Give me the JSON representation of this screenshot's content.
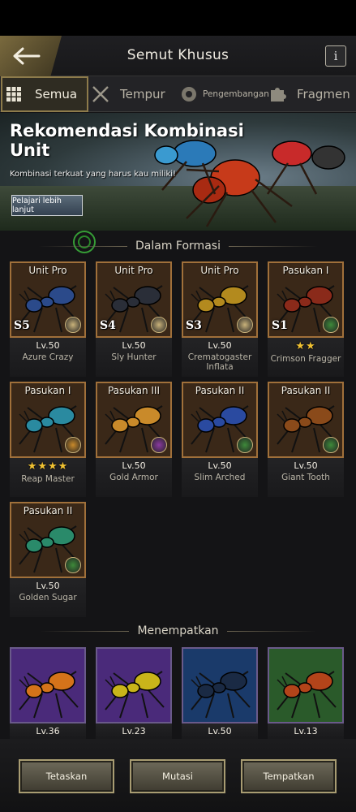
{
  "header": {
    "title": "Semut Khusus",
    "back_icon": "arrow-left-icon",
    "info_label": "i"
  },
  "tabs": [
    {
      "label": "Semua",
      "icon": "grid-icon",
      "active": true
    },
    {
      "label": "Tempur",
      "icon": "crossed-swords-icon",
      "active": false
    },
    {
      "label": "Pengembangan",
      "icon": "gear-shield-icon",
      "active": false
    },
    {
      "label": "Fragmen",
      "icon": "puzzle-icon",
      "active": false
    }
  ],
  "banner": {
    "title": "Rekomendasi Kombinasi Unit",
    "subtitle": "Kombinasi terkuat yang harus kau miliki!",
    "button_label": "Pelajari lebih lanjut"
  },
  "formation": {
    "heading": "Dalam Formasi",
    "units": [
      {
        "rank": "Unit Pro",
        "tier": "S5",
        "level": "Lv.50",
        "name": "Azure Crazy",
        "stars": "",
        "body": "#2b4a8a",
        "badge": "#c9b27a"
      },
      {
        "rank": "Unit Pro",
        "tier": "S4",
        "level": "Lv.50",
        "name": "Sly Hunter",
        "stars": "",
        "body": "#2a2e38",
        "badge": "#c9b27a"
      },
      {
        "rank": "Unit Pro",
        "tier": "S3",
        "level": "Lv.50",
        "name": "Crematogaster Inflata",
        "stars": "",
        "body": "#b38a1e",
        "badge": "#c9b27a"
      },
      {
        "rank": "Pasukan I",
        "tier": "S1",
        "level": "",
        "name": "Crimson Fragger",
        "stars": "★★",
        "body": "#8a2a1a",
        "badge": "#3e8a3a"
      },
      {
        "rank": "Pasukan I",
        "tier": "",
        "level": "",
        "name": "Reap Master",
        "stars": "★★★★",
        "body": "#2a8aa0",
        "badge": "#c98a2a"
      },
      {
        "rank": "Pasukan III",
        "tier": "",
        "level": "Lv.50",
        "name": "Gold Armor",
        "stars": "",
        "body": "#c98a2a",
        "badge": "#8a3aa0"
      },
      {
        "rank": "Pasukan II",
        "tier": "",
        "level": "Lv.50",
        "name": "Slim Arched",
        "stars": "",
        "body": "#2a4aa0",
        "badge": "#3e8a3a"
      },
      {
        "rank": "Pasukan II",
        "tier": "",
        "level": "Lv.50",
        "name": "Giant Tooth",
        "stars": "",
        "body": "#8a4a1a",
        "badge": "#3e8a3a"
      },
      {
        "rank": "Pasukan II",
        "tier": "",
        "level": "Lv.50",
        "name": "Golden Sugar",
        "stars": "",
        "body": "#2a8a6a",
        "badge": "#3e8a3a"
      }
    ]
  },
  "deploy": {
    "heading": "Menempatkan",
    "units": [
      {
        "level": "Lv.36",
        "bg": "#4a2a7a",
        "body": "#d4731a"
      },
      {
        "level": "Lv.23",
        "bg": "#4a2a7a",
        "body": "#c9b41a"
      },
      {
        "level": "Lv.50",
        "bg": "#1a3a6a",
        "body": "#1a2a44"
      },
      {
        "level": "Lv.13",
        "bg": "#2a5a2a",
        "body": "#b3441a"
      }
    ]
  },
  "bottom": {
    "release": "Tetaskan",
    "mutation": "Mutasi",
    "place": "Tempatkan"
  },
  "colors": {
    "accent": "#a89c72",
    "border_card": "#a0703a",
    "star": "#f1c232"
  }
}
